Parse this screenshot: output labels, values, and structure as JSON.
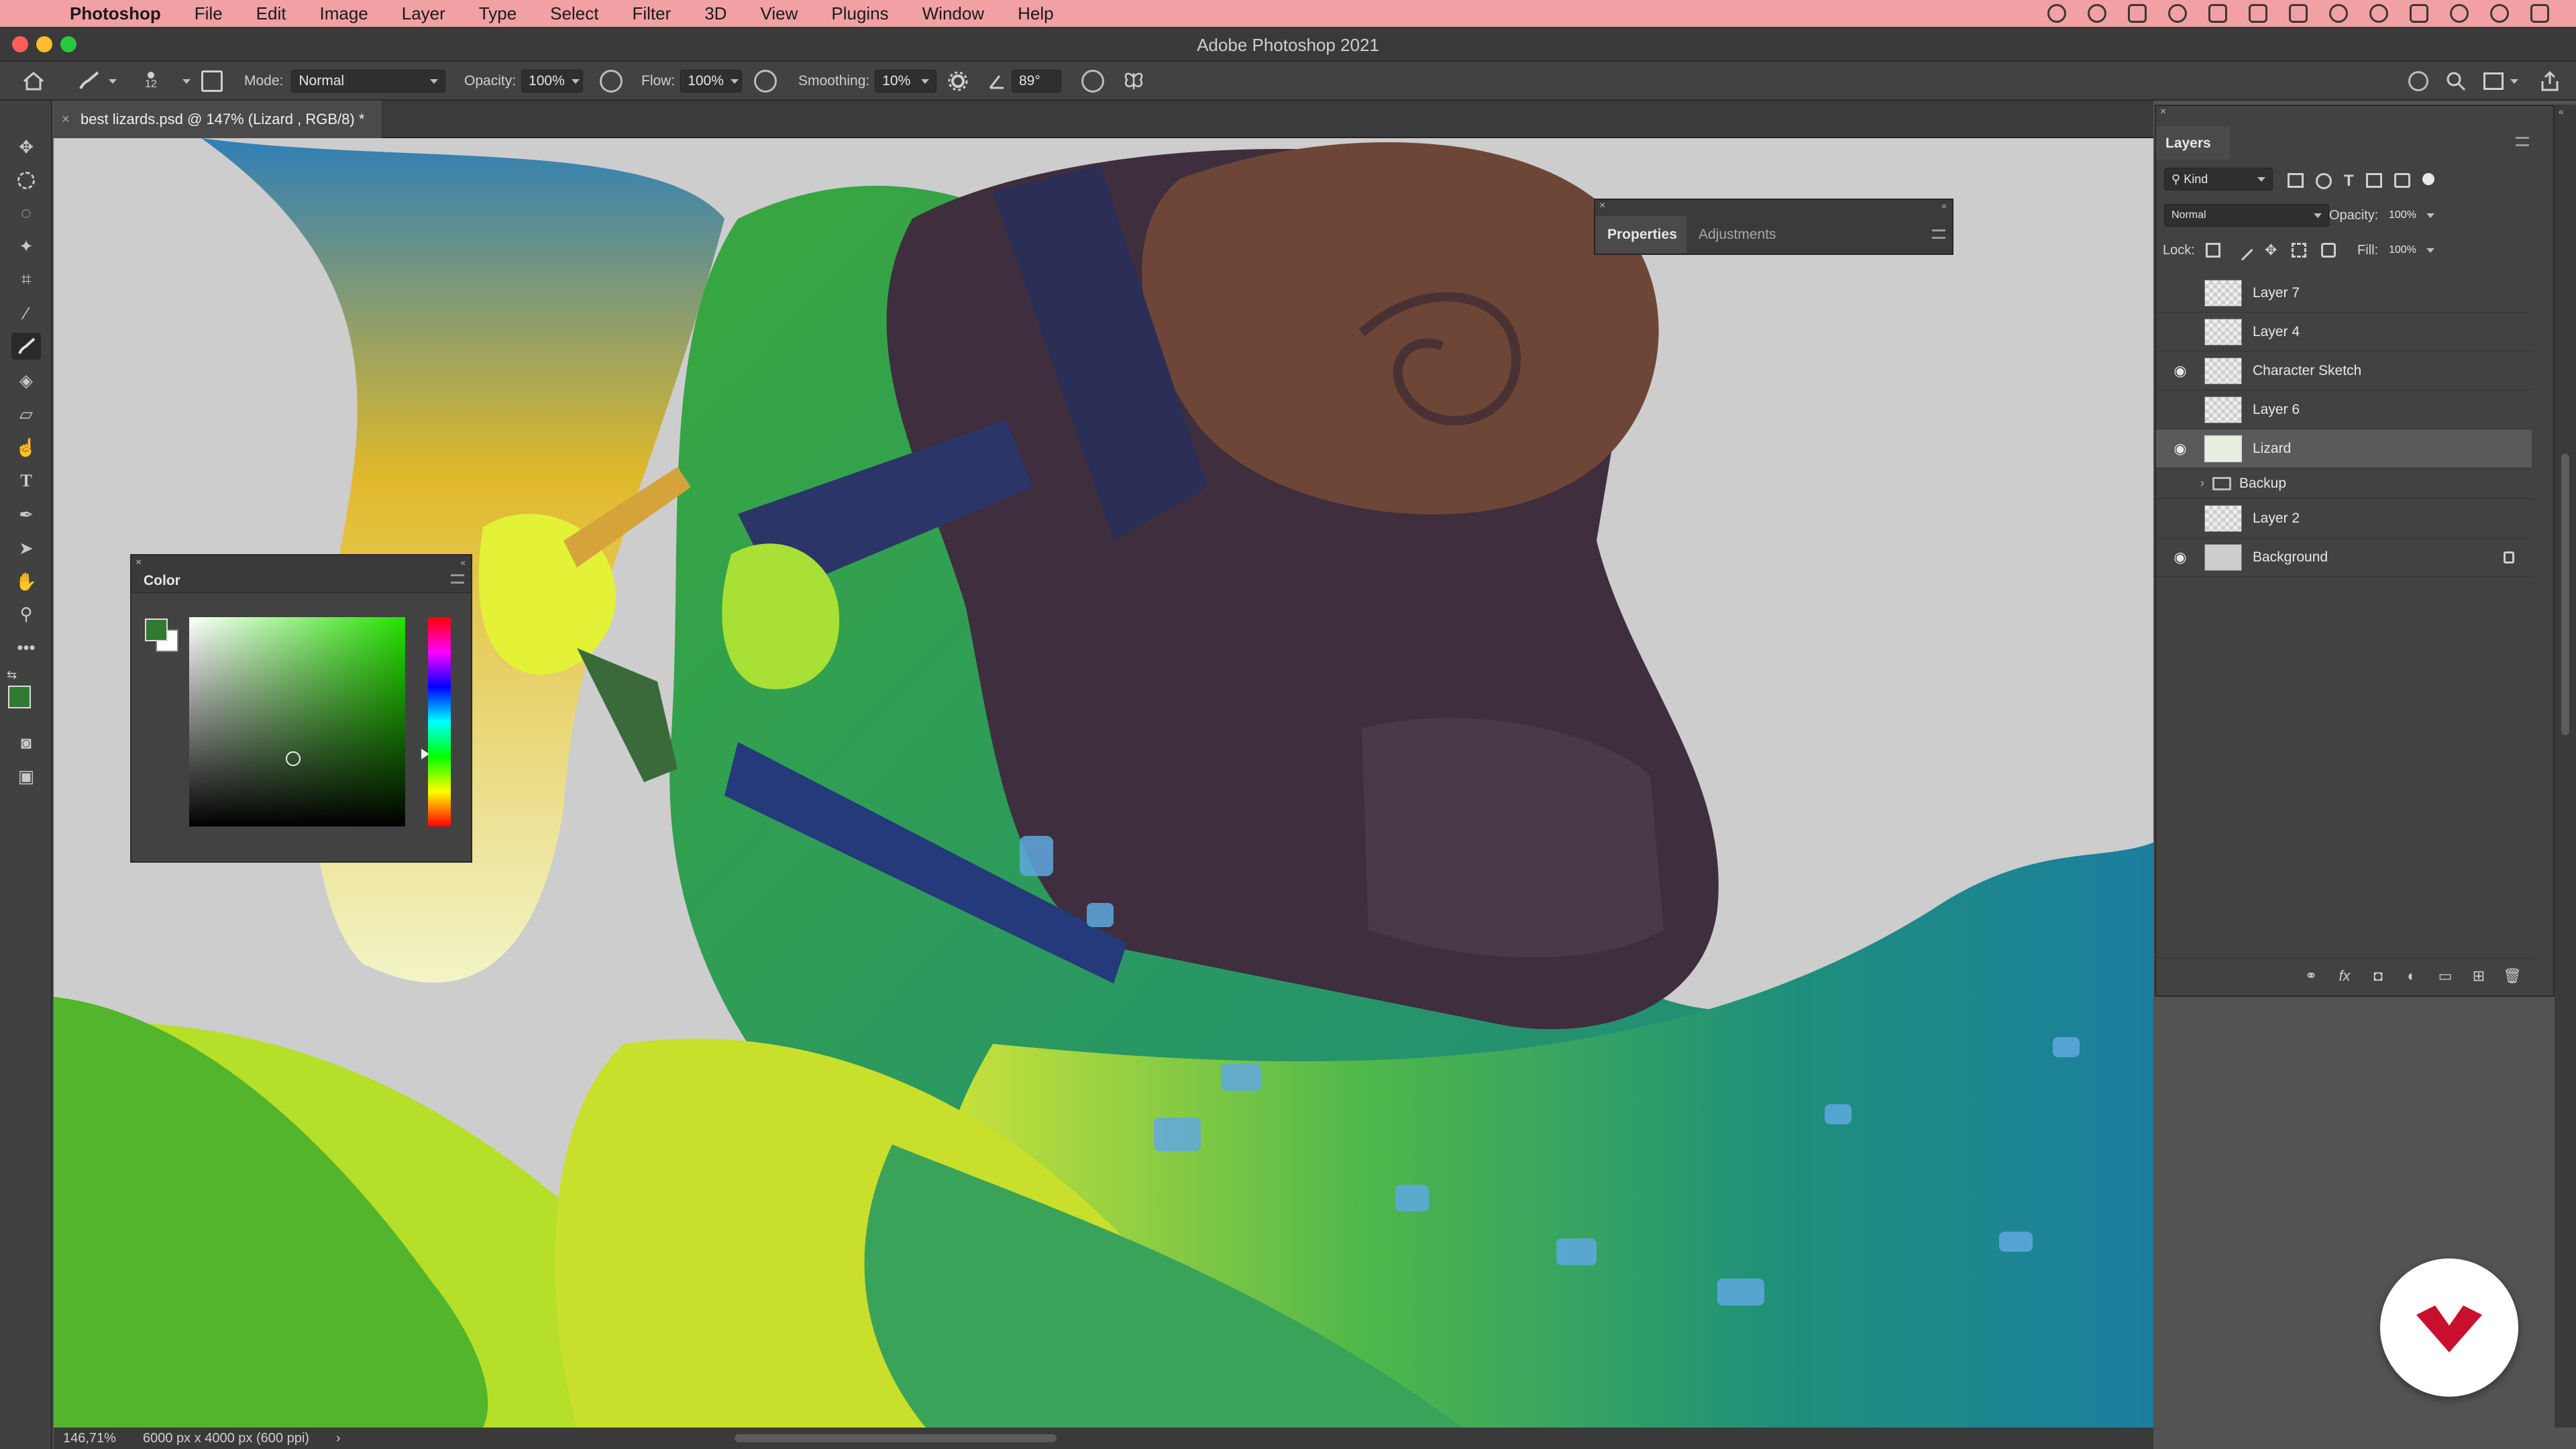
{
  "menubar": {
    "app_name": "Photoshop",
    "items": [
      "File",
      "Edit",
      "Image",
      "Layer",
      "Type",
      "Select",
      "Filter",
      "3D",
      "View",
      "Plugins",
      "Window",
      "Help"
    ]
  },
  "window": {
    "title": "Adobe Photoshop 2021"
  },
  "options": {
    "brush_size": "12",
    "mode_label": "Mode:",
    "mode_value": "Normal",
    "opacity_label": "Opacity:",
    "opacity_value": "100%",
    "flow_label": "Flow:",
    "flow_value": "100%",
    "smoothing_label": "Smoothing:",
    "smoothing_value": "10%",
    "angle_value": "89°"
  },
  "document": {
    "tab_title": "best lizards.psd @ 147% (Lizard , RGB/8) *",
    "close": "×"
  },
  "status": {
    "zoom": "146,71%",
    "doc_size": "6000 px x 4000 px (600 ppi)",
    "arrow": "›"
  },
  "color_panel": {
    "title": "Color",
    "foreground": "#2f7a30",
    "background": "#ffffff"
  },
  "properties_panel": {
    "tabs": [
      "Properties",
      "Adjustments"
    ]
  },
  "layers_panel": {
    "title": "Layers",
    "filter_label": "Kind",
    "blend_mode": "Normal",
    "opacity_label": "Opacity:",
    "opacity_value": "100%",
    "lock_label": "Lock:",
    "fill_label": "Fill:",
    "fill_value": "100%",
    "layers": [
      {
        "name": "Layer 7",
        "visible": false,
        "selected": false
      },
      {
        "name": "Layer 4",
        "visible": false,
        "selected": false
      },
      {
        "name": "Character Sketch",
        "visible": true,
        "selected": false
      },
      {
        "name": "Layer 6",
        "visible": false,
        "selected": false
      },
      {
        "name": "Lizard",
        "visible": true,
        "selected": true
      },
      {
        "name": "Backup",
        "visible": false,
        "selected": false,
        "group": true
      },
      {
        "name": "Layer 2",
        "visible": false,
        "selected": false
      },
      {
        "name": "Background",
        "visible": true,
        "selected": false,
        "locked": true
      }
    ],
    "footer_icons": [
      "link-icon",
      "fx-icon",
      "mask-icon",
      "adjustment-icon",
      "folder-icon",
      "new-layer-icon",
      "trash-icon"
    ]
  },
  "colors": {
    "menubar": "#f1a1a4",
    "panel": "#424242",
    "canvas_bg": "#cdcdcd",
    "logo_red": "#c8102e"
  }
}
